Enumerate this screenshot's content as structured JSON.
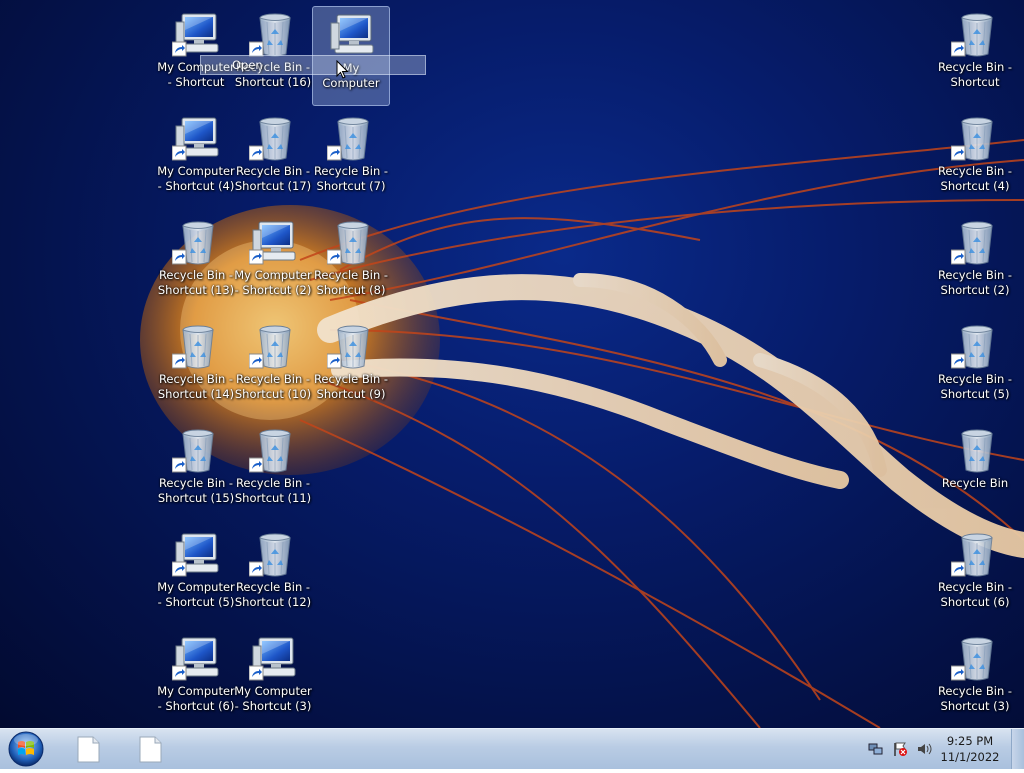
{
  "desktop": {
    "icons": [
      {
        "label": "My Computer\n- Shortcut",
        "type": "computer",
        "shortcut": true
      },
      {
        "label": "Recycle Bin -\nShortcut (16)",
        "type": "recycle",
        "shortcut": true
      },
      {
        "label": "My Computer",
        "type": "computer",
        "shortcut": false,
        "selected": true
      },
      {
        "label": "Recycle Bin -\nShortcut",
        "type": "recycle",
        "shortcut": true
      },
      {
        "label": "My Computer\n- Shortcut (4)",
        "type": "computer",
        "shortcut": true
      },
      {
        "label": "Recycle Bin -\nShortcut (17)",
        "type": "recycle",
        "shortcut": true
      },
      {
        "label": "Recycle Bin -\nShortcut (7)",
        "type": "recycle",
        "shortcut": true
      },
      {
        "label": "Recycle Bin -\nShortcut (4)",
        "type": "recycle",
        "shortcut": true
      },
      {
        "label": "Recycle Bin -\nShortcut (13)",
        "type": "recycle",
        "shortcut": true
      },
      {
        "label": "My Computer\n- Shortcut (2)",
        "type": "computer",
        "shortcut": true
      },
      {
        "label": "Recycle Bin -\nShortcut (8)",
        "type": "recycle",
        "shortcut": true
      },
      {
        "label": "Recycle Bin -\nShortcut (2)",
        "type": "recycle",
        "shortcut": true
      },
      {
        "label": "Recycle Bin -\nShortcut (14)",
        "type": "recycle",
        "shortcut": true
      },
      {
        "label": "Recycle Bin -\nShortcut (10)",
        "type": "recycle",
        "shortcut": true
      },
      {
        "label": "Recycle Bin -\nShortcut (9)",
        "type": "recycle",
        "shortcut": true
      },
      {
        "label": "Recycle Bin -\nShortcut (5)",
        "type": "recycle",
        "shortcut": true
      },
      {
        "label": "Recycle Bin -\nShortcut (15)",
        "type": "recycle",
        "shortcut": true
      },
      {
        "label": "Recycle Bin -\nShortcut (11)",
        "type": "recycle",
        "shortcut": true
      },
      {
        "label": "Recycle Bin",
        "type": "recycle",
        "shortcut": false
      },
      {
        "label": "My Computer\n- Shortcut (5)",
        "type": "computer",
        "shortcut": true
      },
      {
        "label": "Recycle Bin -\nShortcut (12)",
        "type": "recycle",
        "shortcut": true
      },
      {
        "label": "Recycle Bin -\nShortcut (6)",
        "type": "recycle",
        "shortcut": true
      },
      {
        "label": "My Computer\n- Shortcut (6)",
        "type": "computer",
        "shortcut": true
      },
      {
        "label": "My Computer\n- Shortcut (3)",
        "type": "computer",
        "shortcut": true
      },
      {
        "label": "Recycle Bin -\nShortcut (3)",
        "type": "recycle",
        "shortcut": true
      }
    ],
    "context_tooltip": "Open"
  },
  "taskbar": {
    "start_icon": "windows-orb-icon",
    "buttons": [
      {
        "icon": "blank-document-icon"
      },
      {
        "icon": "blank-document-icon"
      }
    ],
    "tray": {
      "icons": [
        "network-icon",
        "action-center-flag-icon",
        "volume-icon"
      ],
      "time": "9:25 PM",
      "date": "11/1/2022"
    }
  },
  "colors": {
    "desktop_bg": "#061c6b",
    "taskbar_bg": "#b9cce4",
    "jellyfish_orange": "#e88a1a"
  }
}
